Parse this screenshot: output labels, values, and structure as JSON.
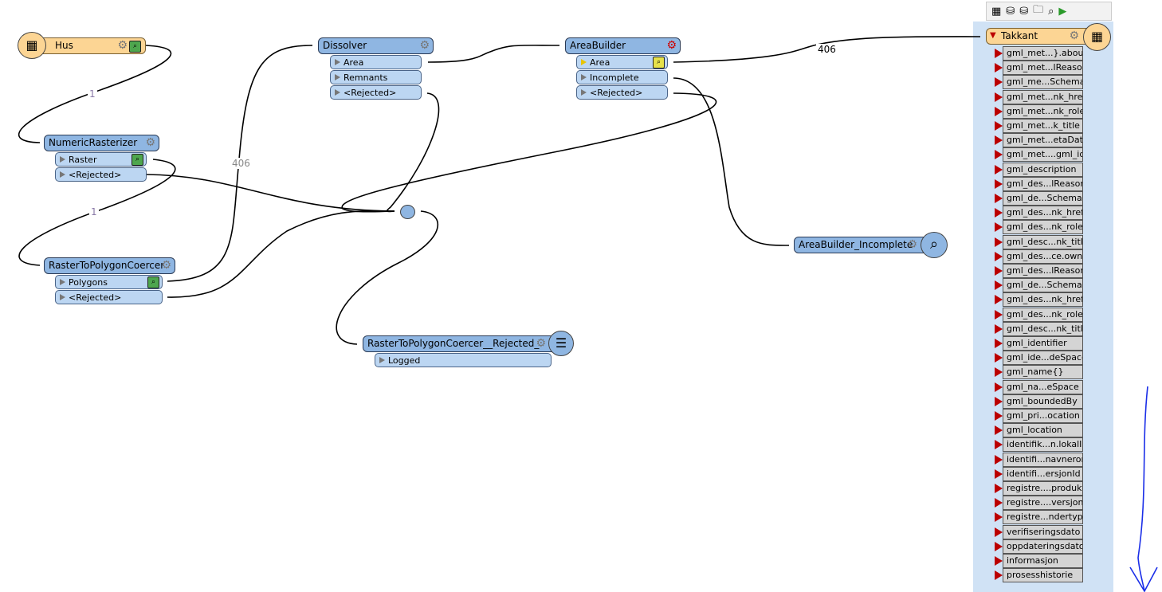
{
  "toolbar": {
    "icons": [
      "add-reader-icon",
      "add-reader-db-icon",
      "add-writer-db-icon",
      "open-folder-icon",
      "inspect-icon",
      "run-icon"
    ]
  },
  "reader_hus": {
    "name": "Hus"
  },
  "numeric": {
    "name": "NumericRasterizer",
    "ports": [
      "Raster",
      "<Rejected>"
    ]
  },
  "r2p": {
    "name": "RasterToPolygonCoercer",
    "ports": [
      "Polygons",
      "<Rejected>"
    ]
  },
  "dissolver": {
    "name": "Dissolver",
    "ports": [
      "Area",
      "Remnants",
      "<Rejected>"
    ]
  },
  "areabuilder": {
    "name": "AreaBuilder",
    "ports": [
      "Area",
      "Incomplete",
      "<Rejected>"
    ]
  },
  "logger": {
    "name": "RasterToPolygonCoercer__Rejected_",
    "ports": [
      "Logged"
    ]
  },
  "inspector": {
    "name": "AreaBuilder_Incomplete"
  },
  "writer": {
    "name": "Takkant",
    "attributes": [
      "gml_met...}.about",
      "gml_met...lReason",
      "gml_me...Schema",
      "gml_met...nk_href",
      "gml_met...nk_role",
      "gml_met...k_title",
      "gml_met...etaData",
      "gml_met....gml_id",
      "gml_description",
      "gml_des...lReason",
      "gml_de...Schema",
      "gml_des...nk_href",
      "gml_des...nk_role",
      "gml_desc...nk_title",
      "gml_des...ce.owns",
      "gml_des...lReason",
      "gml_de...Schema",
      "gml_des...nk_href",
      "gml_des...nk_role",
      "gml_desc...nk_title",
      "gml_identifier",
      "gml_ide...deSpace",
      "gml_name{}",
      "gml_na...eSpace",
      "gml_boundedBy",
      "gml_pri...ocation",
      "gml_location",
      "identifik...n.lokalId",
      "identifi...navnerom",
      "identifi...ersjonId",
      "registre....produkt",
      "registre....versjon",
      "registre...ndertype",
      "verifiseringsdato",
      "oppdateringsdato",
      "informasjon",
      "prosesshistorie"
    ]
  },
  "connection_counts": {
    "hus_to_numeric": "1",
    "raster_to_r2p": "1",
    "polygons_to_dissolver": "406",
    "area_to_writer": "406"
  },
  "colors": {
    "transformer": "#8fb6e2",
    "port": "#bcd6f2",
    "reader": "#fcd594",
    "annotation_arrow": "#1a2ee8"
  }
}
